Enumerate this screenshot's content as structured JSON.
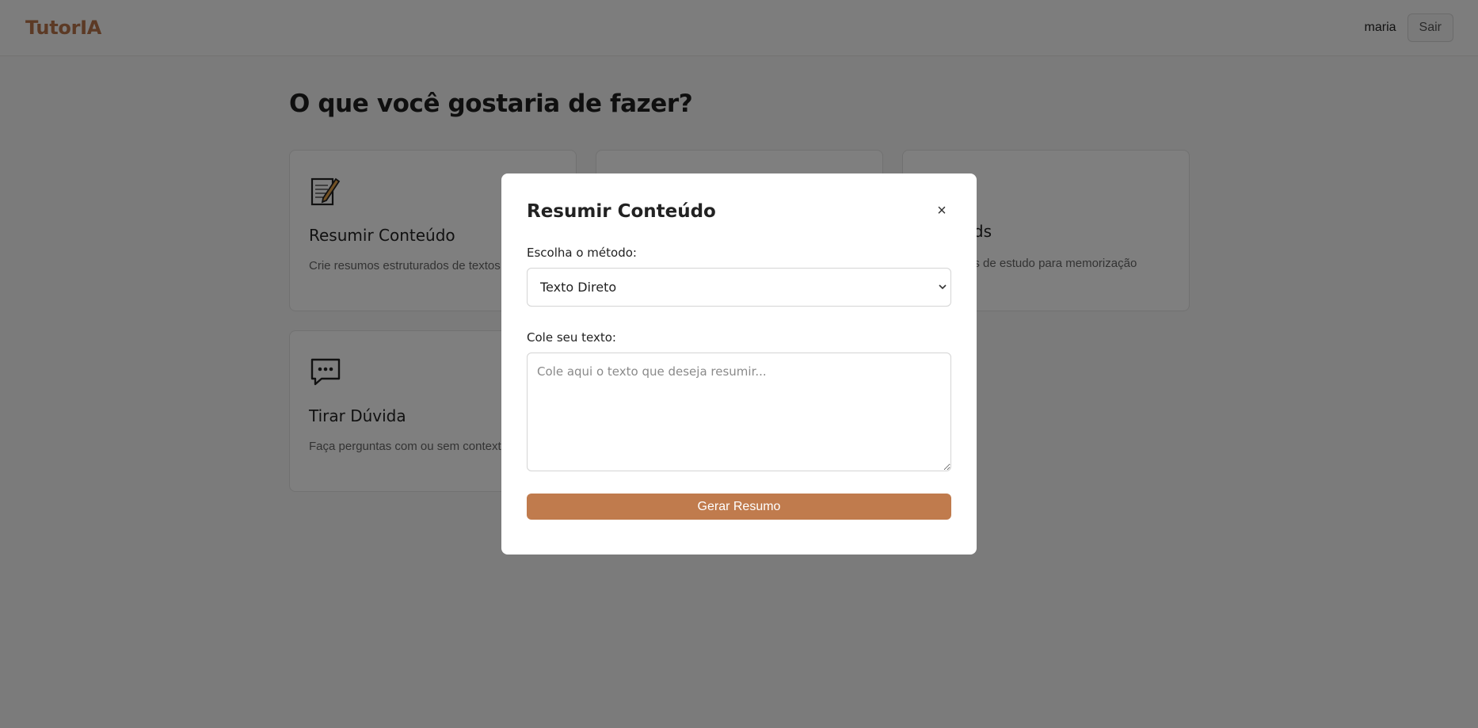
{
  "header": {
    "brand": "TutorIA",
    "username": "maria",
    "logout_label": "Sair"
  },
  "main": {
    "title": "O que você gostaria de fazer?",
    "cards": [
      {
        "icon": "memo-icon",
        "title": "Resumir Conteúdo",
        "description": "Crie resumos estruturados de textos"
      },
      {
        "icon": "",
        "title": "",
        "description": ""
      },
      {
        "icon": "",
        "title": "rds",
        "description": "es de estudo para memorização"
      },
      {
        "icon": "speech-bubble-icon",
        "title": "Tirar Dúvida",
        "description": "Faça perguntas com ou sem context"
      }
    ]
  },
  "modal": {
    "title": "Resumir Conteúdo",
    "close_label": "×",
    "method_label": "Escolha o método:",
    "method_value": "Texto Direto",
    "text_label": "Cole seu texto:",
    "text_placeholder": "Cole aqui o texto que deseja resumir...",
    "text_value": "",
    "submit_label": "Gerar Resumo"
  },
  "colors": {
    "brand": "#b8744a",
    "accent_button": "#c07b4d",
    "overlay": "rgba(0,0,0,0.5)"
  }
}
